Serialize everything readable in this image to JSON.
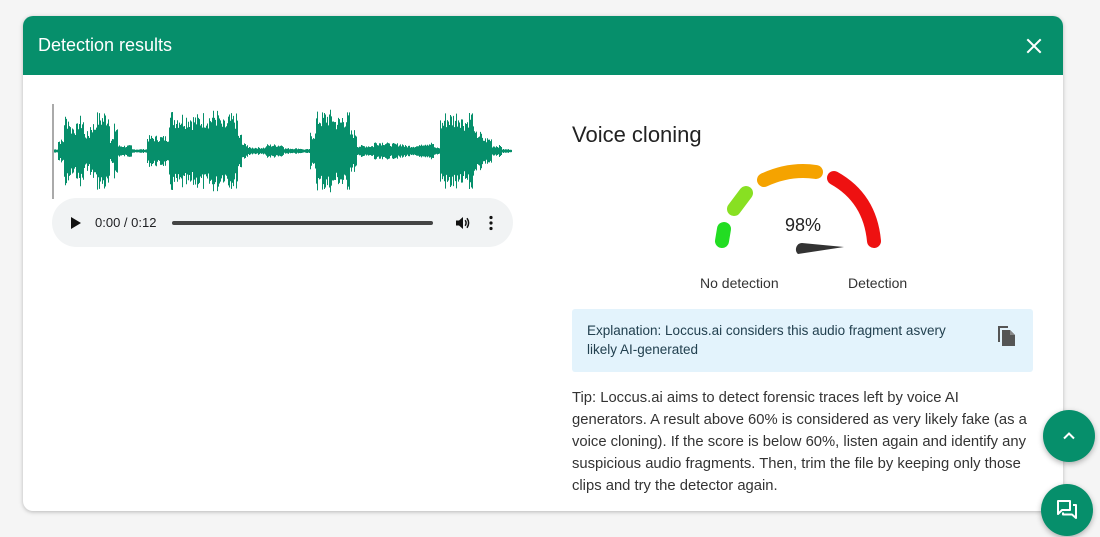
{
  "modal": {
    "title": "Detection results"
  },
  "audio": {
    "time": "0:00 / 0:12",
    "waveform_color": "#068f6b"
  },
  "result": {
    "section_title": "Voice cloning",
    "score": 98,
    "score_label": "98%",
    "gauge_left_label": "No detection",
    "gauge_right_label": "Detection",
    "explanation": "Explanation: Loccus.ai considers this audio fragment asvery likely AI-generated",
    "tip": "Tip: Loccus.ai aims to detect forensic traces left by voice AI generators. A result above 60% is considered as very likely fake (as a voice cloning). If the score is below 60%, listen again and identify any suspicious audio fragments. Then, trim the file by keeping only those clips and try the detector again."
  },
  "colors": {
    "brand": "#068f6b",
    "explanation_bg": "#e3f3fc",
    "gauge_green": "#22dd22",
    "gauge_lime": "#88e022",
    "gauge_orange": "#f5a300",
    "gauge_red": "#ee1111",
    "needle": "#333333"
  },
  "icons": {
    "close": "close-icon",
    "play": "play-icon",
    "volume": "volume-icon",
    "more": "more-vert-icon",
    "copy": "copy-icon",
    "scroll_top": "chevron-up-icon",
    "chat": "chat-icon"
  }
}
